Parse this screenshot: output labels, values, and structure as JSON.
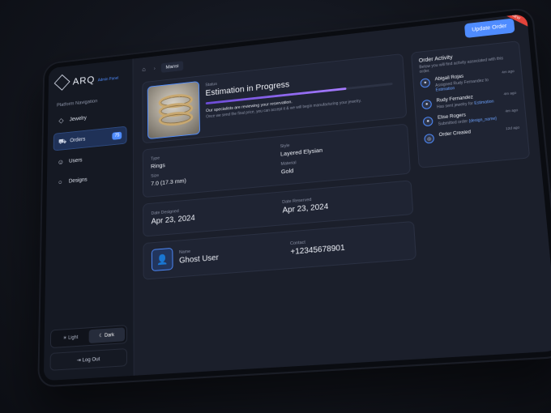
{
  "app": {
    "logo": "ARQ",
    "subtitle": "Admin Panel"
  },
  "sidebar": {
    "heading": "Platform Navigation",
    "items": [
      {
        "label": "Jewelry",
        "icon": "diamond-icon"
      },
      {
        "label": "Orders",
        "icon": "cart-icon",
        "badge": "75"
      },
      {
        "label": "Users",
        "icon": "users-icon"
      },
      {
        "label": "Designs",
        "icon": "ring-icon"
      }
    ],
    "theme": {
      "light": "Light",
      "dark": "Dark"
    },
    "logout": "Log Out"
  },
  "topbar": {
    "crumb": "Mansi",
    "update_button": "Update Order",
    "ribbon": "NEW"
  },
  "status": {
    "label": "Status",
    "title": "Estimation in Progress",
    "progress": 0.76,
    "message": "Our specialists are reviewing your reservation.",
    "sub": "Once we send the final price, you can accept it & we will begin manufacturing your jewelry."
  },
  "details": {
    "type_label": "Type",
    "type_value": "Rings",
    "style_label": "Style",
    "style_value": "Layered Elysian",
    "size_label": "Size",
    "size_value": "7.0 (17.3 mm)",
    "material_label": "Material",
    "material_value": "Gold"
  },
  "dates": {
    "designed_label": "Date Designed",
    "designed_value": "Apr 23, 2024",
    "reserved_label": "Date Reserved",
    "reserved_value": "Apr 23, 2024"
  },
  "customer": {
    "name_label": "Name",
    "name_value": "Ghost User",
    "contact_label": "Contact",
    "contact_value": "+12345678901"
  },
  "activity": {
    "title": "Order Activity",
    "subtitle": "Below you will find activity associated with this order.",
    "items": [
      {
        "name": "Abigail Rojas",
        "desc": "Assigned Rudy Fernandez to",
        "link": "Estimation",
        "time": "4m ago"
      },
      {
        "name": "Rudy Fernandez",
        "desc": "Has sent jewelry for",
        "link": "Estimation",
        "time": "4m ago"
      },
      {
        "name": "Elise Rogers",
        "desc": "Submitted order",
        "link": "{design_name}",
        "time": "4m ago"
      },
      {
        "name": "Order Created",
        "desc": "",
        "link": "",
        "time": "12d ago"
      }
    ]
  }
}
